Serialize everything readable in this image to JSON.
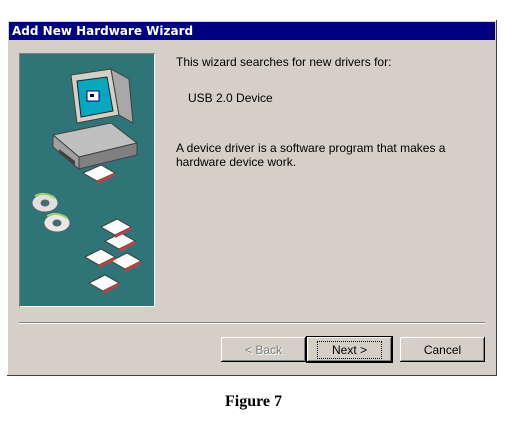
{
  "window": {
    "title": "Add New Hardware Wizard"
  },
  "content": {
    "line1": "This wizard searches for new drivers for:",
    "device": "USB 2.0 Device",
    "description": "A device driver is a software program that makes a hardware device work."
  },
  "buttons": {
    "back": "< Back",
    "next": "Next >",
    "cancel": "Cancel"
  },
  "caption": "Figure 7"
}
